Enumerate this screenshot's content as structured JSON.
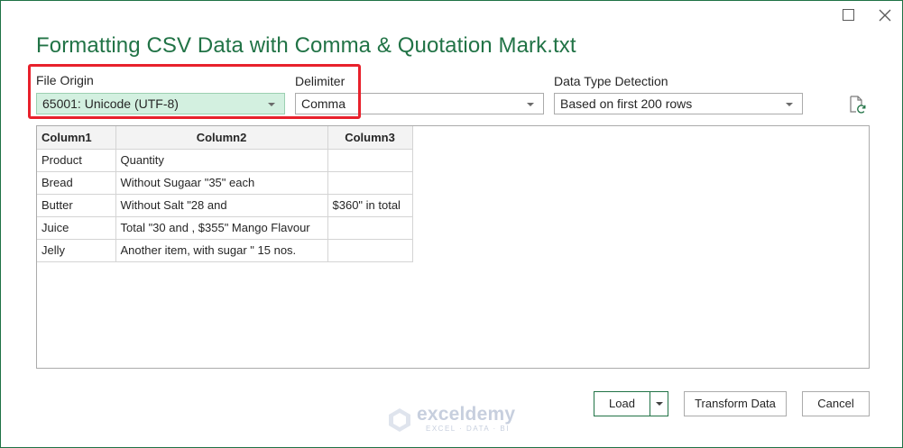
{
  "window": {
    "title": "Formatting CSV Data with Comma & Quotation Mark.txt"
  },
  "options": {
    "file_origin": {
      "label": "File Origin",
      "value": "65001: Unicode (UTF-8)"
    },
    "delimiter": {
      "label": "Delimiter",
      "value": "Comma"
    },
    "data_type_detection": {
      "label": "Data Type Detection",
      "value": "Based on first 200 rows"
    }
  },
  "preview": {
    "headers": [
      "Column1",
      "Column2",
      "Column3"
    ],
    "rows": [
      [
        "Product",
        "Quantity",
        ""
      ],
      [
        "Bread",
        "Without Sugaar \"35\" each",
        ""
      ],
      [
        "Butter",
        "Without Salt \"28 and",
        "$360\" in total"
      ],
      [
        "Juice",
        "Total \"30 and , $355\" Mango Flavour",
        ""
      ],
      [
        "Jelly",
        "Another item, with sugar \" 15 nos.",
        ""
      ]
    ]
  },
  "footer": {
    "load_label": "Load",
    "transform_label": "Transform Data",
    "cancel_label": "Cancel"
  },
  "watermark": {
    "brand": "exceldemy",
    "tagline": "EXCEL · DATA · BI"
  },
  "icons": {
    "maximize": "maximize-icon",
    "close": "close-icon",
    "refresh": "refresh-file-icon",
    "dropdown": "chevron-down-icon"
  },
  "colors": {
    "accent": "#217346",
    "focused_field_bg": "#d3f0e0",
    "highlight_box": "#e8212c"
  }
}
